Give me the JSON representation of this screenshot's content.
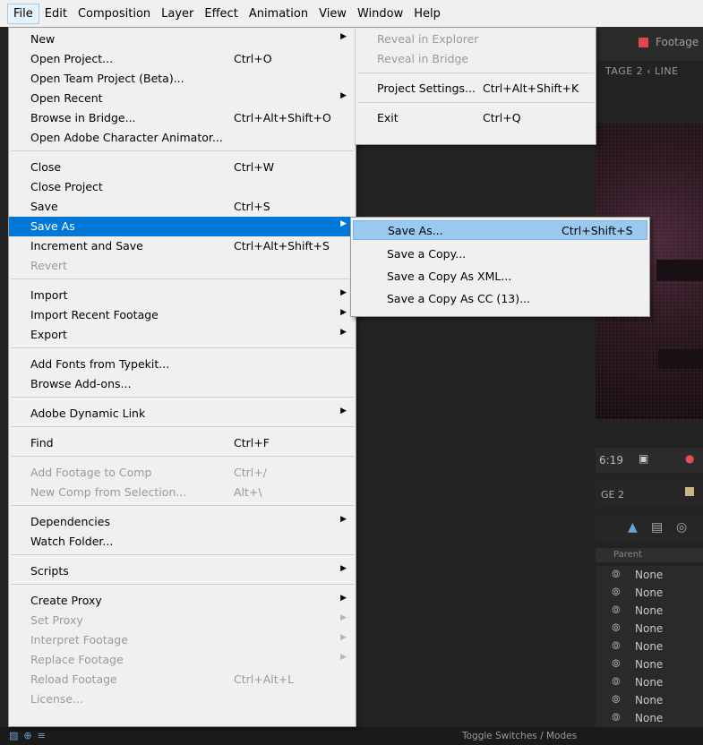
{
  "menubar": {
    "items": [
      "File",
      "Edit",
      "Composition",
      "Layer",
      "Effect",
      "Animation",
      "View",
      "Window",
      "Help"
    ]
  },
  "file_menu": {
    "items": [
      {
        "label": "New",
        "shortcut": "",
        "arrow": "▶",
        "state": "enabled"
      },
      {
        "label": "Open Project...",
        "shortcut": "Ctrl+O",
        "arrow": "",
        "state": "enabled"
      },
      {
        "label": "Open Team Project (Beta)...",
        "shortcut": "",
        "arrow": "",
        "state": "enabled"
      },
      {
        "label": "Open Recent",
        "shortcut": "",
        "arrow": "▶",
        "state": "enabled"
      },
      {
        "label": "Browse in Bridge...",
        "shortcut": "Ctrl+Alt+Shift+O",
        "arrow": "",
        "state": "enabled"
      },
      {
        "label": "Open Adobe Character Animator...",
        "shortcut": "",
        "arrow": "",
        "state": "enabled"
      },
      {
        "label": "Close",
        "shortcut": "Ctrl+W",
        "arrow": "",
        "state": "enabled"
      },
      {
        "label": "Close Project",
        "shortcut": "",
        "arrow": "",
        "state": "enabled"
      },
      {
        "label": "Save",
        "shortcut": "Ctrl+S",
        "arrow": "",
        "state": "enabled"
      },
      {
        "label": "Save As",
        "shortcut": "",
        "arrow": "▶",
        "state": "highlighted"
      },
      {
        "label": "Increment and Save",
        "shortcut": "Ctrl+Alt+Shift+S",
        "arrow": "",
        "state": "enabled"
      },
      {
        "label": "Revert",
        "shortcut": "",
        "arrow": "",
        "state": "disabled"
      },
      {
        "label": "Import",
        "shortcut": "",
        "arrow": "▶",
        "state": "enabled"
      },
      {
        "label": "Import Recent Footage",
        "shortcut": "",
        "arrow": "▶",
        "state": "enabled"
      },
      {
        "label": "Export",
        "shortcut": "",
        "arrow": "▶",
        "state": "enabled"
      },
      {
        "label": "Add Fonts from Typekit...",
        "shortcut": "",
        "arrow": "",
        "state": "enabled"
      },
      {
        "label": "Browse Add-ons...",
        "shortcut": "",
        "arrow": "",
        "state": "enabled"
      },
      {
        "label": "Adobe Dynamic Link",
        "shortcut": "",
        "arrow": "▶",
        "state": "enabled"
      },
      {
        "label": "Find",
        "shortcut": "Ctrl+F",
        "arrow": "",
        "state": "enabled"
      },
      {
        "label": "Add Footage to Comp",
        "shortcut": "Ctrl+/",
        "arrow": "",
        "state": "disabled"
      },
      {
        "label": "New Comp from Selection...",
        "shortcut": "Alt+\\",
        "arrow": "",
        "state": "disabled"
      },
      {
        "label": "Dependencies",
        "shortcut": "",
        "arrow": "▶",
        "state": "enabled"
      },
      {
        "label": "Watch Folder...",
        "shortcut": "",
        "arrow": "",
        "state": "enabled"
      },
      {
        "label": "Scripts",
        "shortcut": "",
        "arrow": "▶",
        "state": "enabled"
      },
      {
        "label": "Create Proxy",
        "shortcut": "",
        "arrow": "▶",
        "state": "enabled"
      },
      {
        "label": "Set Proxy",
        "shortcut": "",
        "arrow": "▶",
        "state": "disabled"
      },
      {
        "label": "Interpret Footage",
        "shortcut": "",
        "arrow": "▶",
        "state": "disabled"
      },
      {
        "label": "Replace Footage",
        "shortcut": "",
        "arrow": "▶",
        "state": "disabled"
      },
      {
        "label": "Reload Footage",
        "shortcut": "Ctrl+Alt+L",
        "arrow": "",
        "state": "disabled"
      },
      {
        "label": "License...",
        "shortcut": "",
        "arrow": "",
        "state": "disabled"
      }
    ]
  },
  "window_menu": {
    "items": [
      {
        "label": "Reveal in Explorer",
        "shortcut": "",
        "state": "disabled"
      },
      {
        "label": "Reveal in Bridge",
        "shortcut": "",
        "state": "disabled"
      },
      {
        "label": "Project Settings...",
        "shortcut": "Ctrl+Alt+Shift+K",
        "state": "enabled"
      },
      {
        "label": "Exit",
        "shortcut": "Ctrl+Q",
        "state": "enabled"
      }
    ]
  },
  "save_as_menu": {
    "items": [
      {
        "label": "Save As...",
        "shortcut": "Ctrl+Shift+S",
        "state": "highlighted"
      },
      {
        "label": "Save a Copy...",
        "shortcut": "",
        "state": "enabled"
      },
      {
        "label": "Save a Copy As XML...",
        "shortcut": "",
        "state": "enabled"
      },
      {
        "label": "Save a Copy As CC (13)...",
        "shortcut": "",
        "state": "enabled"
      }
    ]
  },
  "background": {
    "footage_tab": "Footage",
    "breadcrumb": "TAGE 2  ‹  LINE",
    "timecode": "6:19",
    "timeline_tab": "GE 2",
    "parent_header": "Parent",
    "parent_values": [
      "None",
      "None",
      "None",
      "None",
      "None",
      "None",
      "None",
      "None",
      "None"
    ],
    "toggle_label": "Toggle Switches / Modes"
  },
  "colors": {
    "menu_bg": "#f0f0f0",
    "highlight": "#0078d7",
    "submenu_highlight": "#99c9ef",
    "disabled_text": "#9a9a9a",
    "footage_swatch": "#e0474c"
  }
}
